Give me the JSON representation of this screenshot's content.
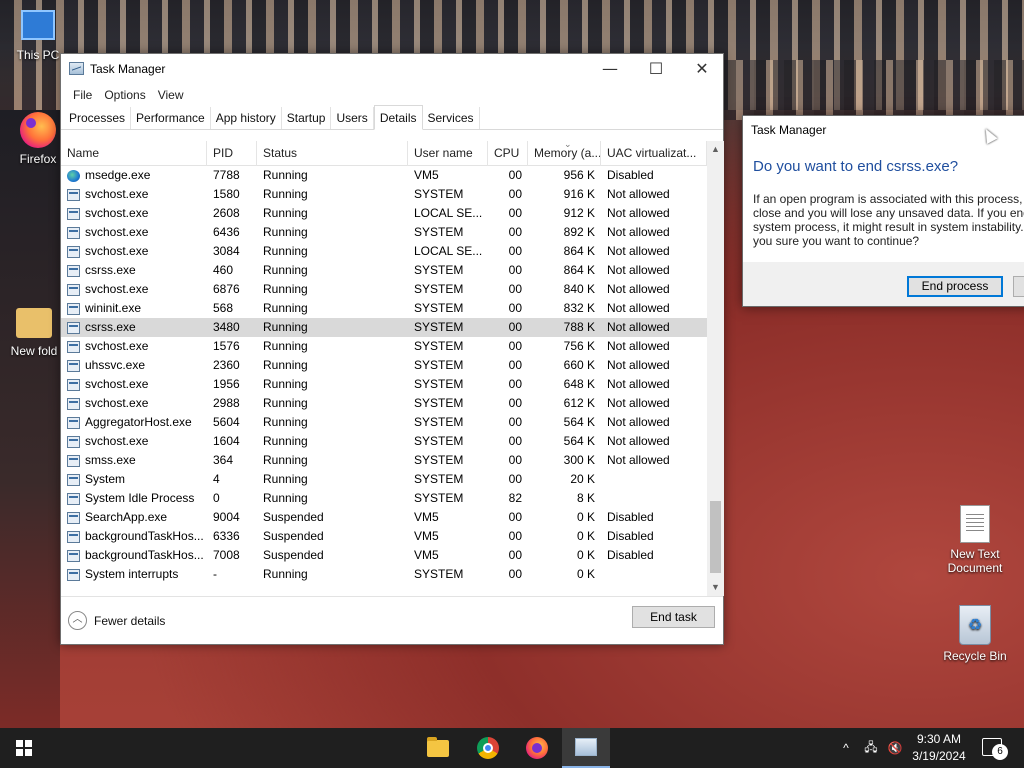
{
  "desktop": {
    "icons": [
      {
        "label": "This PC"
      },
      {
        "label": "Firefox"
      },
      {
        "label": "New fold"
      },
      {
        "label": "New Text Document"
      },
      {
        "label": "Recycle Bin"
      }
    ]
  },
  "task_manager": {
    "title": "Task Manager",
    "window_buttons": {
      "minimize": "—",
      "maximize": "☐",
      "close": "✕"
    },
    "menu": [
      "File",
      "Options",
      "View"
    ],
    "tabs": [
      "Processes",
      "Performance",
      "App history",
      "Startup",
      "Users",
      "Details",
      "Services"
    ],
    "active_tab": "Details",
    "columns": [
      "Name",
      "PID",
      "Status",
      "User name",
      "CPU",
      "Memory (a...",
      "UAC virtualizat..."
    ],
    "rows": [
      {
        "name": "msedge.exe",
        "pid": "7788",
        "status": "Running",
        "user": "VM5",
        "cpu": "00",
        "mem": "956 K",
        "uac": "Disabled",
        "icon": "edge-icon"
      },
      {
        "name": "svchost.exe",
        "pid": "1580",
        "status": "Running",
        "user": "SYSTEM",
        "cpu": "00",
        "mem": "916 K",
        "uac": "Not allowed",
        "icon": "process-icon"
      },
      {
        "name": "svchost.exe",
        "pid": "2608",
        "status": "Running",
        "user": "LOCAL SE...",
        "cpu": "00",
        "mem": "912 K",
        "uac": "Not allowed",
        "icon": "process-icon"
      },
      {
        "name": "svchost.exe",
        "pid": "6436",
        "status": "Running",
        "user": "SYSTEM",
        "cpu": "00",
        "mem": "892 K",
        "uac": "Not allowed",
        "icon": "process-icon"
      },
      {
        "name": "svchost.exe",
        "pid": "3084",
        "status": "Running",
        "user": "LOCAL SE...",
        "cpu": "00",
        "mem": "864 K",
        "uac": "Not allowed",
        "icon": "process-icon"
      },
      {
        "name": "csrss.exe",
        "pid": "460",
        "status": "Running",
        "user": "SYSTEM",
        "cpu": "00",
        "mem": "864 K",
        "uac": "Not allowed",
        "icon": "process-icon"
      },
      {
        "name": "svchost.exe",
        "pid": "6876",
        "status": "Running",
        "user": "SYSTEM",
        "cpu": "00",
        "mem": "840 K",
        "uac": "Not allowed",
        "icon": "process-icon"
      },
      {
        "name": "wininit.exe",
        "pid": "568",
        "status": "Running",
        "user": "SYSTEM",
        "cpu": "00",
        "mem": "832 K",
        "uac": "Not allowed",
        "icon": "process-icon"
      },
      {
        "name": "csrss.exe",
        "pid": "3480",
        "status": "Running",
        "user": "SYSTEM",
        "cpu": "00",
        "mem": "788 K",
        "uac": "Not allowed",
        "icon": "process-icon",
        "selected": true
      },
      {
        "name": "svchost.exe",
        "pid": "1576",
        "status": "Running",
        "user": "SYSTEM",
        "cpu": "00",
        "mem": "756 K",
        "uac": "Not allowed",
        "icon": "process-icon"
      },
      {
        "name": "uhssvc.exe",
        "pid": "2360",
        "status": "Running",
        "user": "SYSTEM",
        "cpu": "00",
        "mem": "660 K",
        "uac": "Not allowed",
        "icon": "process-icon"
      },
      {
        "name": "svchost.exe",
        "pid": "1956",
        "status": "Running",
        "user": "SYSTEM",
        "cpu": "00",
        "mem": "648 K",
        "uac": "Not allowed",
        "icon": "process-icon"
      },
      {
        "name": "svchost.exe",
        "pid": "2988",
        "status": "Running",
        "user": "SYSTEM",
        "cpu": "00",
        "mem": "612 K",
        "uac": "Not allowed",
        "icon": "process-icon"
      },
      {
        "name": "AggregatorHost.exe",
        "pid": "5604",
        "status": "Running",
        "user": "SYSTEM",
        "cpu": "00",
        "mem": "564 K",
        "uac": "Not allowed",
        "icon": "process-icon"
      },
      {
        "name": "svchost.exe",
        "pid": "1604",
        "status": "Running",
        "user": "SYSTEM",
        "cpu": "00",
        "mem": "564 K",
        "uac": "Not allowed",
        "icon": "process-icon"
      },
      {
        "name": "smss.exe",
        "pid": "364",
        "status": "Running",
        "user": "SYSTEM",
        "cpu": "00",
        "mem": "300 K",
        "uac": "Not allowed",
        "icon": "process-icon"
      },
      {
        "name": "System",
        "pid": "4",
        "status": "Running",
        "user": "SYSTEM",
        "cpu": "00",
        "mem": "20 K",
        "uac": "",
        "icon": "process-icon"
      },
      {
        "name": "System Idle Process",
        "pid": "0",
        "status": "Running",
        "user": "SYSTEM",
        "cpu": "82",
        "mem": "8 K",
        "uac": "",
        "icon": "process-icon"
      },
      {
        "name": "SearchApp.exe",
        "pid": "9004",
        "status": "Suspended",
        "user": "VM5",
        "cpu": "00",
        "mem": "0 K",
        "uac": "Disabled",
        "icon": "process-icon"
      },
      {
        "name": "backgroundTaskHos...",
        "pid": "6336",
        "status": "Suspended",
        "user": "VM5",
        "cpu": "00",
        "mem": "0 K",
        "uac": "Disabled",
        "icon": "process-icon"
      },
      {
        "name": "backgroundTaskHos...",
        "pid": "7008",
        "status": "Suspended",
        "user": "VM5",
        "cpu": "00",
        "mem": "0 K",
        "uac": "Disabled",
        "icon": "process-icon"
      },
      {
        "name": "System interrupts",
        "pid": "-",
        "status": "Running",
        "user": "SYSTEM",
        "cpu": "00",
        "mem": "0 K",
        "uac": "",
        "icon": "process-icon"
      }
    ],
    "fewer_details_label": "Fewer details",
    "end_task_label": "End task"
  },
  "dialog": {
    "title": "Task Manager",
    "heading": "Do you want to end csrss.exe?",
    "body": "If an open program is associated with this process, it will close and you will lose any unsaved data. If you end a system process, it might result in system instability. Are you sure you want to continue?",
    "end_process_label": "End process"
  },
  "taskbar": {
    "apps": [
      {
        "name": "file-explorer",
        "active": false
      },
      {
        "name": "chrome",
        "active": false
      },
      {
        "name": "firefox",
        "active": false
      },
      {
        "name": "task-manager",
        "active": true
      }
    ],
    "tray": {
      "chevron": "^",
      "network": "🖧",
      "volume": "🔇"
    },
    "time": "9:30 AM",
    "date": "3/19/2024",
    "notification_count": "6"
  }
}
